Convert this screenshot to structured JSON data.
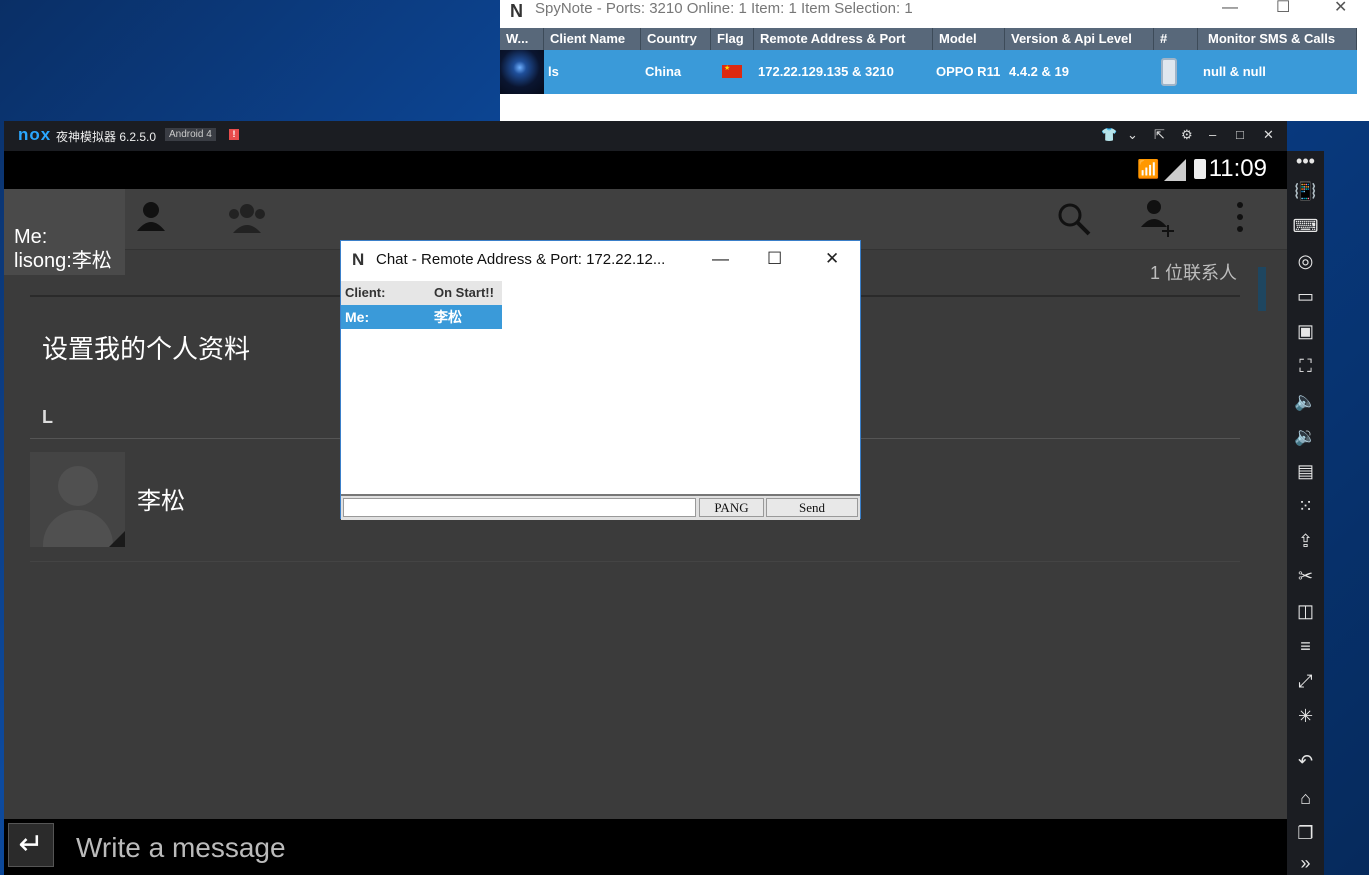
{
  "spynote": {
    "logo": "N",
    "title": "SpyNote - Ports: 3210 Online: 1 Item: 1 Item Selection: 1",
    "window_controls": [
      "—",
      "☐",
      "✕"
    ],
    "columns": [
      "W...",
      "Client Name",
      "Country",
      "Flag",
      "Remote Address & Port",
      "Model",
      "Version & Api Level",
      "#",
      "Monitor SMS & Calls"
    ],
    "row": {
      "client_name": "ls",
      "country": "China",
      "flag_icon": "flag-china-icon",
      "remote": "172.22.129.135 & 3210",
      "model": "OPPO R11",
      "version": "4.4.2 & 19",
      "device_icon": "phone-icon",
      "monitor": "null & null"
    },
    "colors": {
      "header": "#58687a",
      "selected_row": "#3a9ad9"
    }
  },
  "nox": {
    "logo": "nox",
    "version": "夜神模拟器 6.2.5.0",
    "android": "Android 4",
    "alert": "!",
    "toolbar_icons": [
      "shirt-icon",
      "chevron-down-icon",
      "pin-icon",
      "gear-icon",
      "minimize-icon",
      "maximize-icon",
      "close-icon"
    ],
    "clock": "11:09",
    "sidebar_icons": [
      "more-icon",
      "shake-icon",
      "keyboard-icon",
      "location-icon",
      "screen-icon",
      "record-icon",
      "fullscreen-icon",
      "volume-up-icon",
      "volume-down-icon",
      "toolbox-icon",
      "multi-drive-icon",
      "apk-icon",
      "scissors-icon",
      "multi-window-icon",
      "menu-icon",
      "link-icon",
      "loading-icon",
      "back-icon",
      "home-icon",
      "recent-apps-icon",
      "expand-icon"
    ]
  },
  "app": {
    "me_line1": "Me:",
    "me_line2": "lisong:李松",
    "contact_count": "1 位联系人",
    "profile_text": "设置我的个人资料",
    "section": "L",
    "contact_name": "李松",
    "message_placeholder": "Write a message"
  },
  "chat": {
    "logo": "N",
    "title": "Chat - Remote Address & Port: 172.22.12...",
    "controls": [
      "—",
      "☐",
      "✕"
    ],
    "header": {
      "key": "Client:",
      "value": "On Start!!"
    },
    "row": {
      "key": "Me:",
      "value": "李松"
    },
    "pang_label": "PANG",
    "send_label": "Send"
  }
}
